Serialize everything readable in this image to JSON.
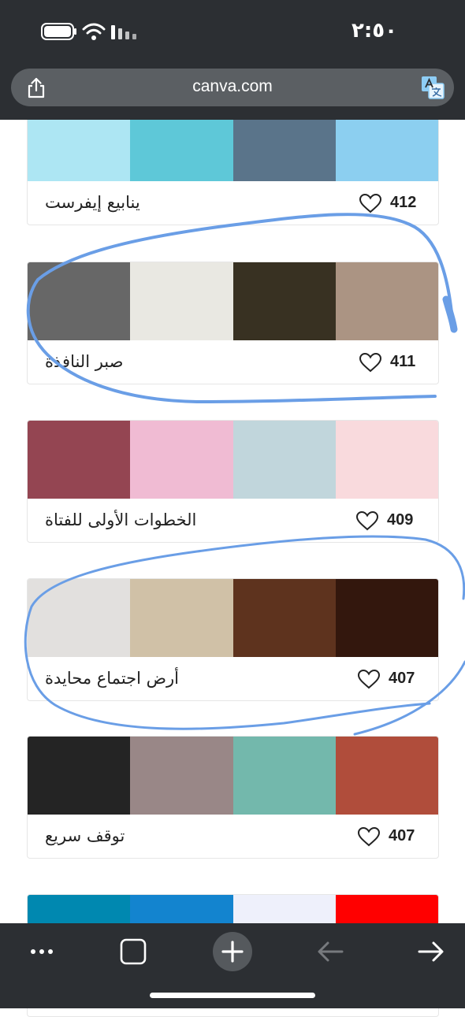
{
  "status_bar": {
    "time": "٢:٥٠"
  },
  "browser": {
    "url": "canva.com"
  },
  "palettes": [
    {
      "name": "ينابيع إيفرست",
      "likes": "412",
      "colors": [
        "#ade6f3",
        "#5ec8d8",
        "#5a748a",
        "#8ccff0"
      ]
    },
    {
      "name": "صبر النافذة",
      "likes": "411",
      "colors": [
        "#676767",
        "#e9e8e2",
        "#383122",
        "#ab9483"
      ]
    },
    {
      "name": "الخطوات الأولى للفتاة",
      "likes": "409",
      "colors": [
        "#944552",
        "#f0bbd3",
        "#c1d6dc",
        "#f9dadd"
      ]
    },
    {
      "name": "أرض اجتماع محايدة",
      "likes": "407",
      "colors": [
        "#e2e0de",
        "#d0c1a7",
        "#5e331e",
        "#33170d"
      ]
    },
    {
      "name": "توقف سريع",
      "likes": "407",
      "colors": [
        "#242424",
        "#998787",
        "#73b8ac",
        "#b04d3b"
      ]
    },
    {
      "name": "",
      "likes": "",
      "colors": [
        "#0088b0",
        "#1384cf",
        "#eef0fb",
        "#ff0000"
      ]
    }
  ],
  "annotation_color": "#6a9ee6"
}
